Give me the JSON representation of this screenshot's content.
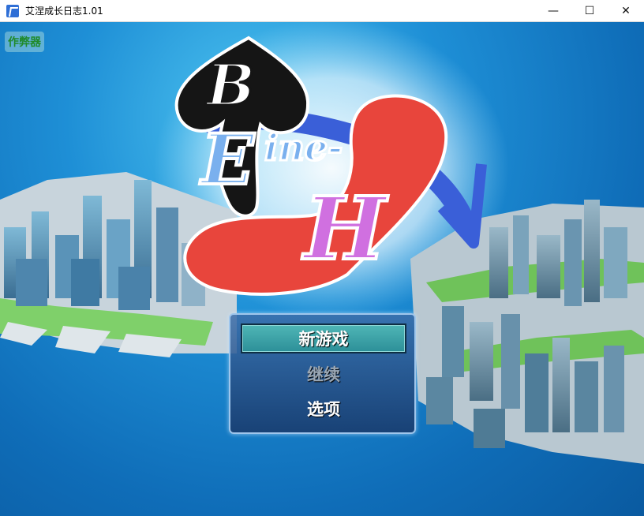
{
  "window": {
    "title": "艾涅成长日志1.01",
    "controls": {
      "minimize": "—",
      "maximize": "☐",
      "close": "✕"
    }
  },
  "overlay": {
    "cheat_label": "作弊器"
  },
  "logo": {
    "line1": "B",
    "line2": "Eine-",
    "line3": "H"
  },
  "menu": {
    "items": [
      {
        "label": "新游戏",
        "state": "selected"
      },
      {
        "label": "继续",
        "state": "disabled"
      },
      {
        "label": "选项",
        "state": "normal"
      }
    ]
  },
  "colors": {
    "sea": "#1e8fd6",
    "logo_red": "#e8453c",
    "logo_blue": "#3a5fd8",
    "logo_black": "#151515",
    "logo_purple": "#d070e0",
    "logo_lightblue": "#7ab0ee",
    "menu_selected": "#3aa4aa"
  }
}
